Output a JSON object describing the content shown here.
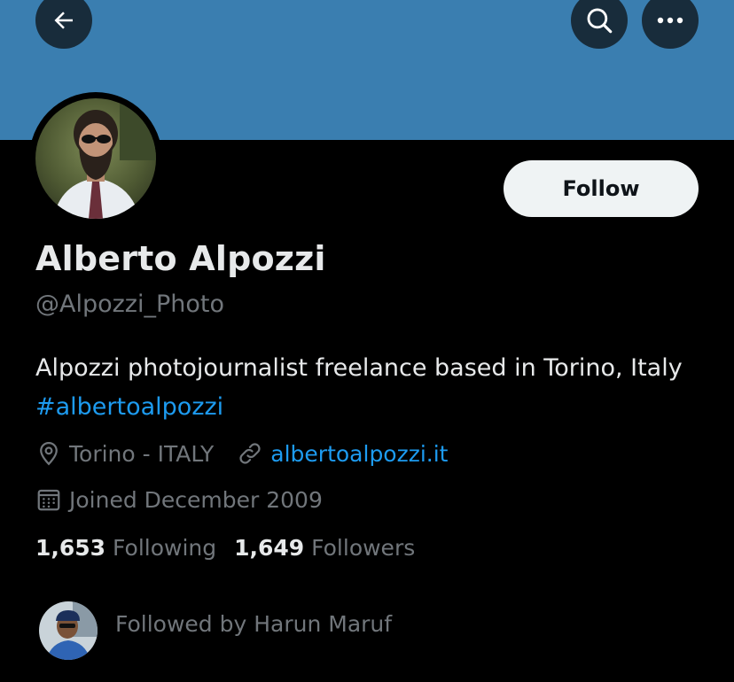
{
  "header": {
    "back_icon": "arrow-left-icon",
    "search_icon": "search-icon",
    "more_icon": "more-horizontal-icon",
    "banner_color": "#3a7eb0"
  },
  "profile": {
    "name": "Alberto Alpozzi",
    "handle": "@Alpozzi_Photo",
    "follow_label": "Follow",
    "bio_text": "Alpozzi photojournalist freelance based in Torino, Italy ",
    "bio_hashtag": "#albertoalpozzi",
    "location": "Torino - ITALY",
    "website": "albertoalpozzi.it",
    "joined": "Joined December 2009",
    "following_count": "1,653",
    "following_label": "Following",
    "followers_count": "1,649",
    "followers_label": "Followers",
    "followed_by": "Followed by Harun Maruf"
  },
  "colors": {
    "link": "#1d9bf0",
    "muted": "#71767b",
    "text": "#e7e9ea"
  }
}
